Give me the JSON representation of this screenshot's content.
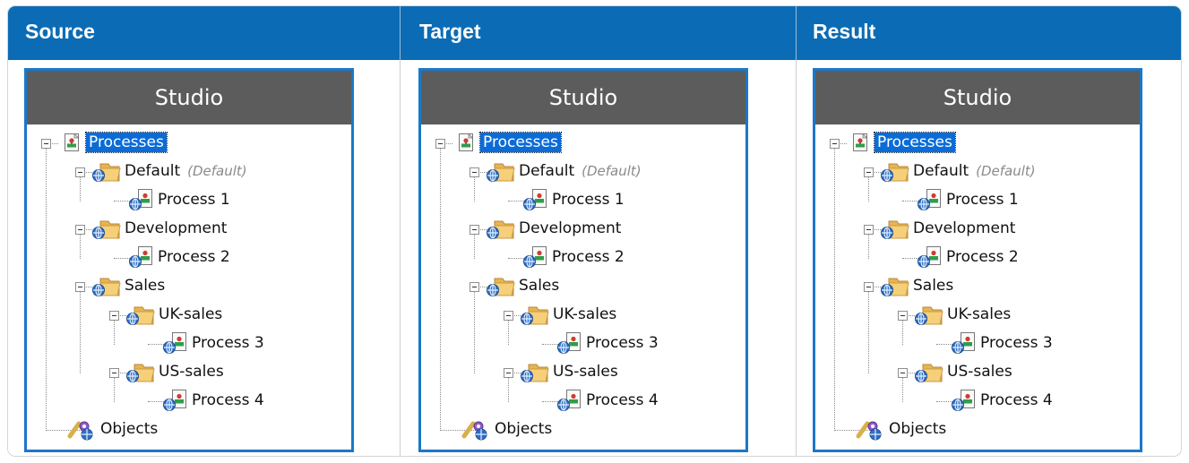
{
  "columns": [
    {
      "id": "source",
      "header": "Source"
    },
    {
      "id": "target",
      "header": "Target"
    },
    {
      "id": "result",
      "header": "Result"
    }
  ],
  "studio": {
    "title": "Studio",
    "nodes": [
      {
        "id": "processes",
        "label": "Processes",
        "level": 0,
        "icon": "processes-icon",
        "selected": true,
        "expanded": true
      },
      {
        "id": "default",
        "label": "Default",
        "tag": "(Default)",
        "level": 1,
        "icon": "folder-icon",
        "expanded": true
      },
      {
        "id": "process-1",
        "label": "Process 1",
        "level": 2,
        "icon": "process-icon"
      },
      {
        "id": "development",
        "label": "Development",
        "level": 1,
        "icon": "folder-icon",
        "expanded": true
      },
      {
        "id": "process-2",
        "label": "Process 2",
        "level": 2,
        "icon": "process-icon"
      },
      {
        "id": "sales",
        "label": "Sales",
        "level": 1,
        "icon": "folder-icon",
        "expanded": true
      },
      {
        "id": "uk-sales",
        "label": "UK-sales",
        "level": 2,
        "icon": "folder-icon",
        "expanded": true
      },
      {
        "id": "process-3",
        "label": "Process 3",
        "level": 3,
        "icon": "process-icon"
      },
      {
        "id": "us-sales",
        "label": "US-sales",
        "level": 2,
        "icon": "folder-icon",
        "expanded": true
      },
      {
        "id": "process-4",
        "label": "Process 4",
        "level": 3,
        "icon": "process-icon"
      },
      {
        "id": "objects",
        "label": "Objects",
        "level": 0,
        "icon": "objects-icon"
      }
    ]
  },
  "colors": {
    "header": "#0b6cb5",
    "panel_border": "#1b78c8",
    "panel_title_bg": "#5c5c5c",
    "selection": "#0b6cd8",
    "tag": "#8a8a8a"
  }
}
